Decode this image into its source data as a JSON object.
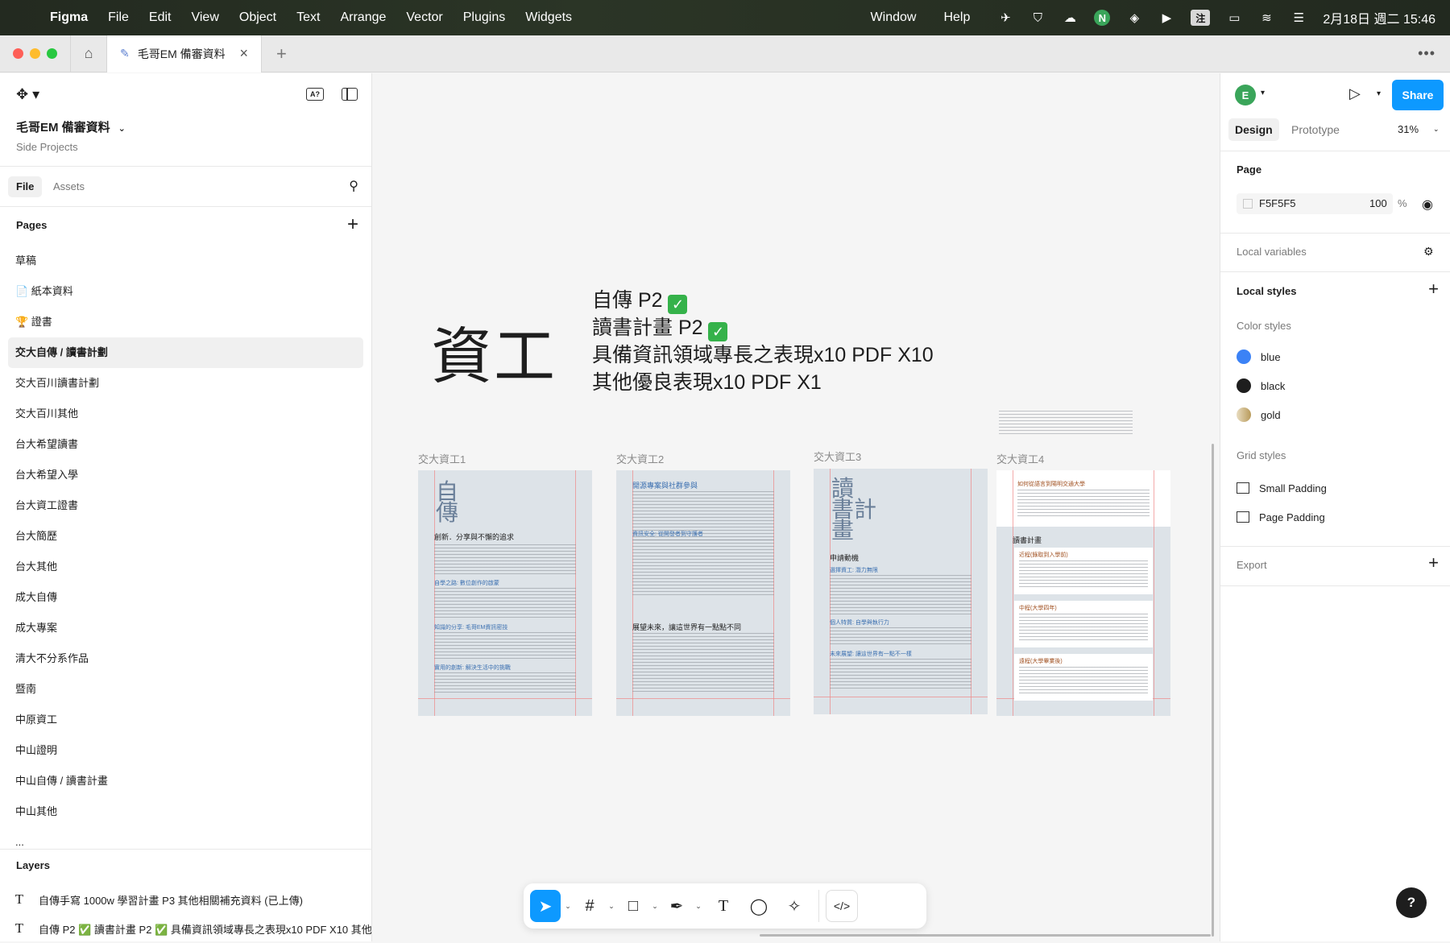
{
  "menubar": {
    "app": "Figma",
    "items": [
      "File",
      "Edit",
      "View",
      "Object",
      "Text",
      "Arrange",
      "Vector",
      "Plugins",
      "Widgets"
    ],
    "right_items": [
      "Window",
      "Help"
    ],
    "tray_n": "N",
    "tray_input": "注",
    "clock": "2月18日 週二 15:46"
  },
  "tabs": {
    "file_tab": "毛哥EM 備審資料"
  },
  "left": {
    "file_title": "毛哥EM 備審資料",
    "file_subtitle": "Side Projects",
    "tab_file": "File",
    "tab_assets": "Assets",
    "pages_label": "Pages",
    "pages": [
      "草稿",
      "📄 紙本資料",
      "🏆 證書",
      "交大自傳 / 讀書計劃",
      "交大百川讀書計劃",
      "交大百川其他",
      "台大希望讀書",
      "台大希望入學",
      "台大資工證書",
      "台大簡歷",
      "台大其他",
      "成大自傳",
      "成大專案",
      "清大不分系作品",
      "暨南",
      "中原資工",
      "中山證明",
      "中山自傳 / 讀書計畫",
      "中山其他",
      "..."
    ],
    "active_page_index": 3,
    "layers_label": "Layers",
    "layers": [
      "自傳手寫 1000w 學習計畫 P3 其他相關補充資料 (已上傳)",
      "自傳 P2 ✅ 讀書計畫 P2 ✅ 具備資訊領域專長之表現x10 PDF X10 其他"
    ]
  },
  "canvas": {
    "big_title": "資工",
    "status": {
      "line1": "自傳 P2",
      "line2": "讀書計畫 P2",
      "line3": "具備資訊領域專長之表現x10 PDF X10",
      "line4": "其他優良表現x10 PDF X1",
      "check": "✓"
    },
    "frames": [
      {
        "label": "交大資工1",
        "big_chars": "自\n傳",
        "heading": "創新．分享與不懈的追求",
        "sub1": "自學之路: 數位創作的啟蒙",
        "sub2": "知識的分享: 毛哥EM資訊密技",
        "sub3": "實用的創新: 解決生活中的挑戰"
      },
      {
        "label": "交大資工2",
        "heading": "開源專案與社群參與",
        "sub1": "資訊安全: 從開發者到守護者",
        "sub2": "展望未來，讓這世界有一點點不同"
      },
      {
        "label": "交大資工3",
        "big_chars": "讀\n書計\n畫",
        "heading": "申請動機",
        "sub1": "選擇資工: 潛力無限",
        "sub2": "個人特質: 自學與執行力",
        "sub3": "未來展望: 讓這世界有一點不一樣"
      },
      {
        "label": "交大資工4",
        "heading": "如何從語言到陽明交通大學",
        "sub1": "讀書計畫",
        "sub2": "近程(錄取到入學前)",
        "sub3": "中程(大學四年)",
        "sub4": "遠程(大學畢業後)"
      }
    ]
  },
  "right": {
    "avatar": "E",
    "share": "Share",
    "tab_design": "Design",
    "tab_prototype": "Prototype",
    "zoom": "31%",
    "page_label": "Page",
    "page_fill_hex": "F5F5F5",
    "page_fill_opacity": "100",
    "page_fill_pct": "%",
    "local_variables": "Local variables",
    "local_styles": "Local styles",
    "color_styles_label": "Color styles",
    "color_styles": [
      {
        "name": "blue",
        "color": "#3b82f6"
      },
      {
        "name": "black",
        "color": "#1e1e1e"
      },
      {
        "name": "gold",
        "color": "#c9b27a"
      }
    ],
    "grid_styles_label": "Grid styles",
    "grid_styles": [
      "Small Padding",
      "Page Padding"
    ],
    "export_label": "Export"
  },
  "toolbar": {
    "text_tool": "T",
    "dev_mode": "</>"
  },
  "help": "?"
}
